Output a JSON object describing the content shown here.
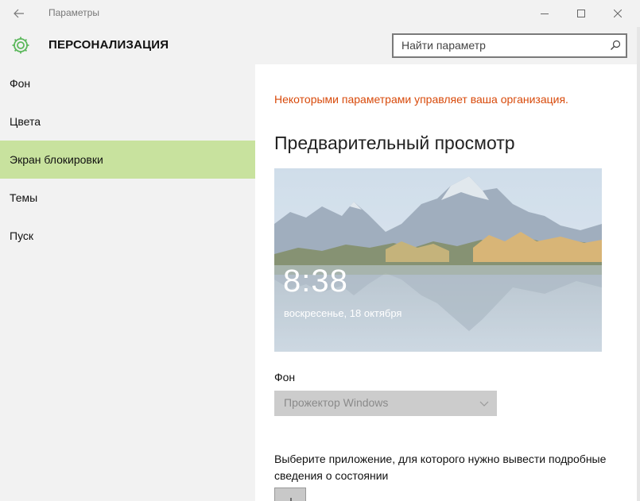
{
  "window": {
    "title": "Параметры",
    "back_icon": "back-arrow-icon",
    "controls": [
      "minimize-icon",
      "maximize-icon",
      "close-icon"
    ]
  },
  "header": {
    "section_title": "ПЕРСОНАЛИЗАЦИЯ",
    "icon": "gear-icon",
    "search_placeholder": "Найти параметр",
    "accent_color": "#5cb85c"
  },
  "sidebar": {
    "items": [
      {
        "label": "Фон",
        "active": false
      },
      {
        "label": "Цвета",
        "active": false
      },
      {
        "label": "Экран блокировки",
        "active": true
      },
      {
        "label": "Темы",
        "active": false
      },
      {
        "label": "Пуск",
        "active": false
      }
    ],
    "active_color": "#c8e29e"
  },
  "content": {
    "org_message": "Некоторыми параметрами управляет ваша организация.",
    "org_message_color": "#d84a0b",
    "preview_title": "Предварительный просмотр",
    "preview": {
      "time": "8:38",
      "date": "воскресенье, 18 октября"
    },
    "background_label": "Фон",
    "background_value": "Прожектор Windows",
    "app_label": "Выберите приложение, для которого нужно вывести подробные сведения о состоянии"
  }
}
